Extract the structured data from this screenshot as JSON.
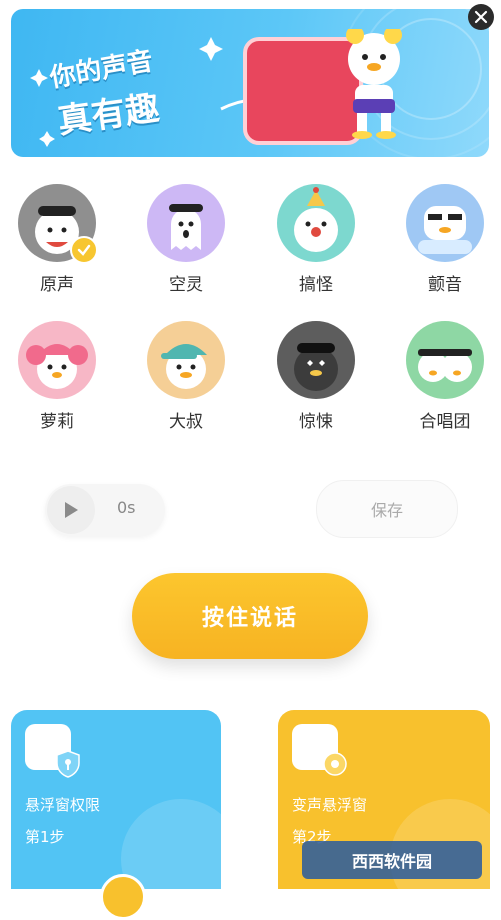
{
  "banner": {
    "line1": "你的声音",
    "line2": "真有趣"
  },
  "voices": [
    {
      "label": "原声",
      "selected": true,
      "bg": "#8f8f8f"
    },
    {
      "label": "空灵",
      "selected": false,
      "bg": "#cdb8f5"
    },
    {
      "label": "搞怪",
      "selected": false,
      "bg": "#7dd8cf"
    },
    {
      "label": "颤音",
      "selected": false,
      "bg": "#9fc8f4"
    },
    {
      "label": "萝莉",
      "selected": false,
      "bg": "#f7b7c6"
    },
    {
      "label": "大叔",
      "selected": false,
      "bg": "#f5cf96"
    },
    {
      "label": "惊悚",
      "selected": false,
      "bg": "#5d5d5d"
    },
    {
      "label": "合唱团",
      "selected": false,
      "bg": "#8ed7a4"
    }
  ],
  "player": {
    "duration": "0s"
  },
  "save_label": "保存",
  "talk_label": "按住说话",
  "cards": [
    {
      "title": "悬浮窗权限",
      "step": "第1步"
    },
    {
      "title": "变声悬浮窗",
      "step": "第2步"
    }
  ],
  "watermark": "西西软件园",
  "colors": {
    "accent_yellow": "#f8c12d",
    "accent_blue": "#52c4f4"
  }
}
